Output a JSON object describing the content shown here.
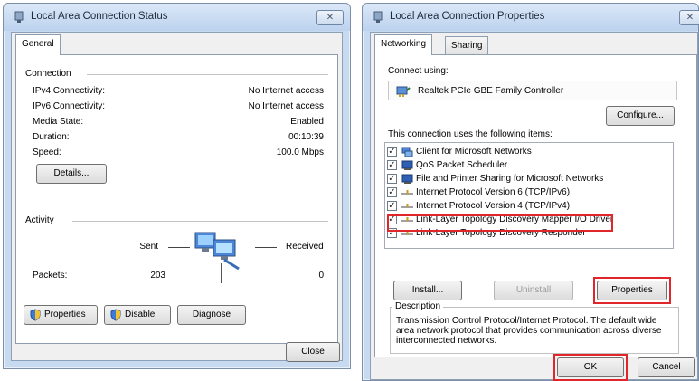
{
  "status_window": {
    "title": "Local Area Connection Status",
    "close_glyph": "✕",
    "tab": "General",
    "connection": {
      "heading": "Connection",
      "rows": [
        {
          "label": "IPv4 Connectivity:",
          "value": "No Internet access"
        },
        {
          "label": "IPv6 Connectivity:",
          "value": "No Internet access"
        },
        {
          "label": "Media State:",
          "value": "Enabled"
        },
        {
          "label": "Duration:",
          "value": "00:10:39"
        },
        {
          "label": "Speed:",
          "value": "100.0 Mbps"
        }
      ],
      "details_button": "Details..."
    },
    "activity": {
      "heading": "Activity",
      "sent_label": "Sent",
      "received_label": "Received",
      "packets_label": "Packets:",
      "packets_sent": "203",
      "packets_received": "0"
    },
    "buttons": {
      "properties": "Properties",
      "disable": "Disable",
      "diagnose": "Diagnose",
      "close": "Close"
    }
  },
  "properties_window": {
    "title": "Local Area Connection Properties",
    "close_glyph": "✕",
    "tabs": [
      "Networking",
      "Sharing"
    ],
    "connect_using_label": "Connect using:",
    "adapter_name": "Realtek PCIe GBE Family Controller",
    "configure_button": "Configure...",
    "items_label": "This connection uses the following items:",
    "items": [
      {
        "label": "Client for Microsoft Networks",
        "checked": true,
        "icon": "network-client-icon"
      },
      {
        "label": "QoS Packet Scheduler",
        "checked": true,
        "icon": "service-icon"
      },
      {
        "label": "File and Printer Sharing for Microsoft Networks",
        "checked": true,
        "icon": "service-icon"
      },
      {
        "label": "Internet Protocol Version 6 (TCP/IPv6)",
        "checked": true,
        "icon": "protocol-icon"
      },
      {
        "label": "Internet Protocol Version 4 (TCP/IPv4)",
        "checked": true,
        "icon": "protocol-icon"
      },
      {
        "label": "Link-Layer Topology Discovery Mapper I/O Driver",
        "checked": true,
        "icon": "protocol-icon"
      },
      {
        "label": "Link-Layer Topology Discovery Responder",
        "checked": true,
        "icon": "protocol-icon"
      }
    ],
    "check_glyph": "✓",
    "install_button": "Install...",
    "uninstall_button": "Uninstall",
    "properties_button": "Properties",
    "description_label": "Description",
    "description_text": "Transmission Control Protocol/Internet Protocol. The default wide area network protocol that provides communication across diverse interconnected networks.",
    "ok_button": "OK",
    "cancel_button": "Cancel"
  },
  "colors": {
    "highlight": "#e0262b",
    "title_bar": "#bcd2ee",
    "dialog_face": "#f0f0f0"
  }
}
